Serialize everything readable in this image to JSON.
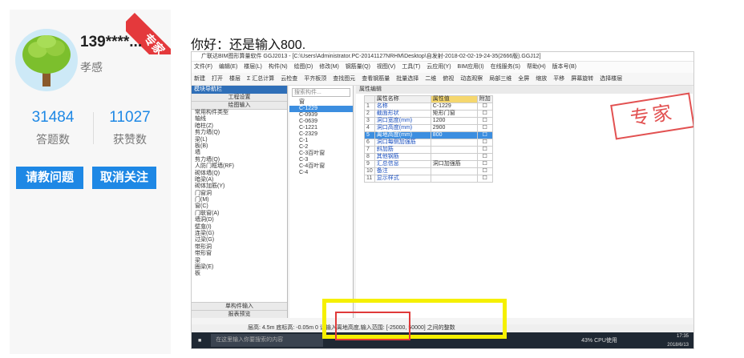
{
  "profile": {
    "username": "139****...",
    "location": "孝感",
    "badge": "专家",
    "answers_count": "31484",
    "answers_label": "答题数",
    "likes_count": "11027",
    "likes_label": "获赞数",
    "ask_button": "请教问题",
    "unfollow_button": "取消关注"
  },
  "answer": {
    "text": "你好：还是输入800."
  },
  "screenshot": {
    "title": "广联达BIM图形算量软件 GGJ2013 - [C:\\Users\\Administrator.PC-20141127NRHM\\Desktop\\自发射-2018-02-02-19-24-35(2666版).GGJ12]",
    "menu": [
      "文件(F)",
      "编辑(E)",
      "楼层(L)",
      "构件(N)",
      "绘图(D)",
      "修改(M)",
      "钢筋量(Q)",
      "视图(V)",
      "工具(T)",
      "云应用(Y)",
      "BIM应用(I)",
      "在线服务(S)",
      "帮助(H)",
      "版本号(B)"
    ],
    "toolbar": [
      "新建",
      "打开",
      "楼层",
      "Σ 汇总计算",
      "云检查",
      "平齐板顶",
      "查找图元",
      "查看钢筋量",
      "批量选择",
      "二维",
      "俯视",
      "动态观察",
      "局部三维",
      "全屏",
      "缩放",
      "平移",
      "屏幕旋转",
      "选择楼层"
    ],
    "nav_title": "模块导航栏",
    "nav_sub1": "工程设置",
    "nav_sub2": "绘图输入",
    "nav_items": [
      "常用构件类型",
      "轴线",
      "暗柱(Z)",
      "剪力墙(Q)",
      "梁(L)",
      "板(B)",
      "墙",
      "剪力墙(Q)",
      "人防门框墙(RF)",
      "砌体墙(Q)",
      "暗梁(A)",
      "砌体加筋(Y)",
      "门窗洞",
      "门(M)",
      "窗(C)",
      "门联窗(A)",
      "墙洞(D)",
      "壁龛(I)",
      "连梁(G)",
      "过梁(G)",
      "带形洞",
      "带形窗",
      "梁",
      "圈梁(E)",
      "板"
    ],
    "nav_bottom": [
      "单构件输入",
      "报表预览"
    ],
    "search_placeholder": "搜索构件...",
    "list_items": [
      "窗",
      "C-1229",
      "C-0939",
      "C-0639",
      "C-1221",
      "C-2329",
      "C-1",
      "C-2",
      "C-3百叶窗",
      "C-3",
      "C-4百叶窗",
      "C-4"
    ],
    "prop_title": "属性编辑",
    "prop_headers": [
      "属性名称",
      "属性值",
      "附加"
    ],
    "props": [
      {
        "idx": "1",
        "name": "名称",
        "value": "C-1229"
      },
      {
        "idx": "2",
        "name": "截面形状",
        "value": "矩形门窗"
      },
      {
        "idx": "3",
        "name": "洞口宽度(mm)",
        "value": "1200"
      },
      {
        "idx": "4",
        "name": "洞口高度(mm)",
        "value": "2900"
      },
      {
        "idx": "5",
        "name": "离地高度(mm)",
        "value": "800"
      },
      {
        "idx": "6",
        "name": "洞口每侧加强筋",
        "value": ""
      },
      {
        "idx": "7",
        "name": "斜加筋",
        "value": ""
      },
      {
        "idx": "8",
        "name": "其他钢筋",
        "value": ""
      },
      {
        "idx": "9",
        "name": "汇总信息",
        "value": "洞口加强筋"
      },
      {
        "idx": "10",
        "name": "备注",
        "value": ""
      },
      {
        "idx": "11",
        "name": "显示样式",
        "value": ""
      }
    ],
    "stamp": "专家",
    "status_text": "层高: 4.5m    底标高: -0.05m    0    请输入离地高度,输入范围: [-25000, 50000] 之间的整数",
    "taskbar_search": "在这里输入你要搜索的内容",
    "tray_text": "43%  CPU使用",
    "clock_time": "17:35",
    "clock_date": "2018/6/13"
  }
}
